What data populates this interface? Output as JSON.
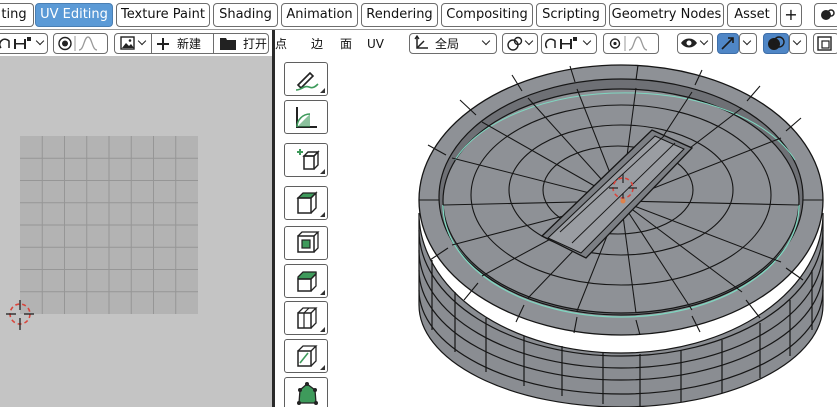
{
  "workspace_tabs": [
    {
      "label": "ting"
    },
    {
      "label": "UV Editing"
    },
    {
      "label": "Texture Paint"
    },
    {
      "label": "Shading"
    },
    {
      "label": "Animation"
    },
    {
      "label": "Rendering"
    },
    {
      "label": "Compositing"
    },
    {
      "label": "Scripting"
    },
    {
      "label": "Geometry Nodes"
    },
    {
      "label": "Asset"
    },
    {
      "label": "+"
    }
  ],
  "active_tab": "UV Editing",
  "uv_header": {
    "new_label": "新建",
    "open_label": "打开"
  },
  "viewport_header": {
    "select_modes": [
      "顶点",
      "边",
      "面"
    ],
    "select_mode_visible": "点",
    "uv_menu": "UV",
    "transform_orientation": "全局"
  },
  "toolbar_tools": [
    {
      "name": "annotate-tool",
      "icon": "annotate-icon"
    },
    {
      "name": "measure-tool",
      "icon": "measure-icon"
    },
    {
      "name": "add-cube-tool",
      "icon": "add-cube-icon"
    },
    {
      "name": "extrude-region-tool",
      "icon": "extrude-icon"
    },
    {
      "name": "inset-faces-tool",
      "icon": "inset-icon"
    },
    {
      "name": "bevel-tool",
      "icon": "bevel-icon"
    },
    {
      "name": "loop-cut-tool",
      "icon": "loop-cut-icon"
    },
    {
      "name": "knife-tool",
      "icon": "knife-icon"
    },
    {
      "name": "poly-build-tool",
      "icon": "poly-build-icon"
    }
  ],
  "colors": {
    "accent": "#5b9ad6",
    "uv_background": "#c4c4c4",
    "uv_grid": "#b3b3b3",
    "mesh_face": "#8e9196",
    "mesh_edge": "#161616",
    "seam_highlight": "#7fd6c0",
    "cursor": "#d9453c"
  }
}
